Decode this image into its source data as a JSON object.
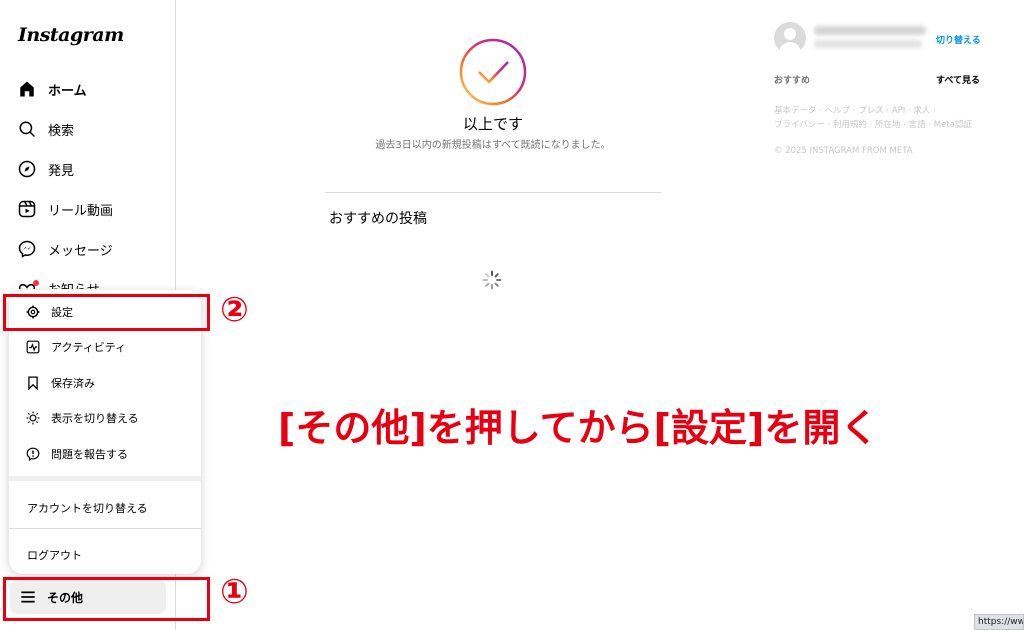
{
  "sidebar": {
    "logo": "Instagram",
    "items": [
      {
        "label": "ホーム",
        "icon": "home-icon"
      },
      {
        "label": "検索",
        "icon": "search-icon"
      },
      {
        "label": "発見",
        "icon": "compass-icon"
      },
      {
        "label": "リール動画",
        "icon": "reels-icon"
      },
      {
        "label": "メッセージ",
        "icon": "messenger-icon"
      },
      {
        "label": "お知らせ",
        "icon": "heart-icon"
      }
    ],
    "more_label": "その他"
  },
  "more_menu": {
    "items": [
      {
        "label": "設定",
        "icon": "gear-icon"
      },
      {
        "label": "アクティビティ",
        "icon": "activity-icon"
      },
      {
        "label": "保存済み",
        "icon": "bookmark-icon"
      },
      {
        "label": "表示を切り替える",
        "icon": "sun-icon"
      },
      {
        "label": "問題を報告する",
        "icon": "report-icon"
      }
    ],
    "switch_account": "アカウントを切り替える",
    "logout": "ログアウト"
  },
  "feed": {
    "caught_up_title": "以上です",
    "caught_up_sub": "過去3日以内の新規投稿はすべて既読になりました。",
    "suggested_posts_title": "おすすめの投稿"
  },
  "right_column": {
    "switch_label": "切り替える",
    "recommended_label": "おすすめ",
    "see_all_label": "すべて見る",
    "footer_line1": "基本データ · ヘルプ · プレス · API · 求人 ·",
    "footer_line2": "プライバシー · 利用規約 · 所在地 · 言語 · Meta認証",
    "copyright": "© 2025 INSTAGRAM FROM META"
  },
  "annotations": {
    "step1": "①",
    "step2": "②",
    "instruction": "[その他]を押してから[設定]を開く",
    "color": "#e60012"
  },
  "status_url": "https://www..."
}
